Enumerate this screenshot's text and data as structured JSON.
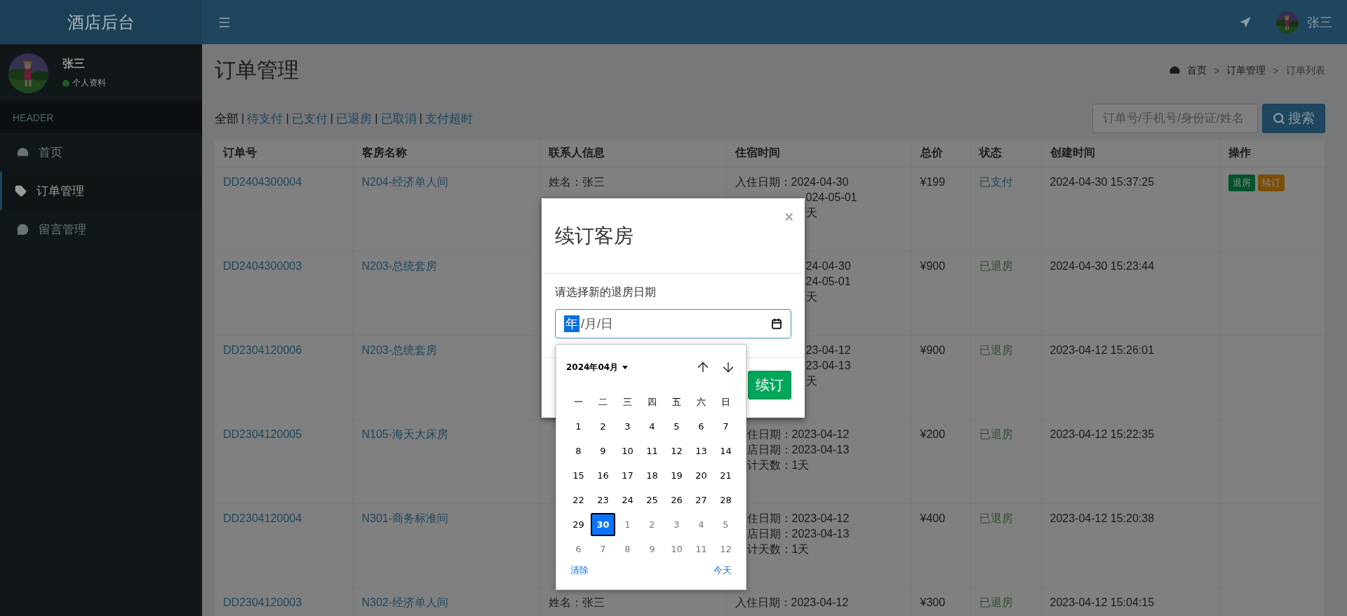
{
  "topbar": {
    "logo": "酒店后台",
    "user": "张三"
  },
  "sidebar": {
    "user": {
      "name": "张三",
      "status": "个人资料"
    },
    "section": "HEADER",
    "items": [
      {
        "label": "首页",
        "selected": false
      },
      {
        "label": "订单管理",
        "selected": true
      },
      {
        "label": "留言管理",
        "selected": false
      }
    ]
  },
  "page": {
    "title": "订单管理",
    "breadcrumb": {
      "separator": ">",
      "items": [
        "首页",
        "订单管理",
        "订单列表"
      ]
    }
  },
  "filters": {
    "separator": "|",
    "items": [
      {
        "label": "全部",
        "selected": true
      },
      {
        "label": "待支付",
        "selected": false
      },
      {
        "label": "已支付",
        "selected": false
      },
      {
        "label": "已退房",
        "selected": false
      },
      {
        "label": "已取消",
        "selected": false
      },
      {
        "label": "支付超时",
        "selected": false
      }
    ]
  },
  "search": {
    "placeholder": "订单号/手机号/身份证/姓名",
    "button": "搜索"
  },
  "table": {
    "columns": [
      "订单号",
      "客房名称",
      "联系人信息",
      "住宿时间",
      "总价",
      "状态",
      "创建时间",
      "操作"
    ],
    "rows": [
      {
        "order": "DD2404300004",
        "room": "N204-经济单人间",
        "contact": [
          "姓名：张三"
        ],
        "stay": [
          {
            "text": "入住日期：2024-04-30",
            "kind": "whole"
          },
          {
            "text": "024-05-01",
            "kind": "after_modal"
          },
          {
            "text": "天",
            "kind": "after_modal"
          }
        ],
        "price": "¥199",
        "status": {
          "text": "已支付",
          "color": "#1e465e"
        },
        "created": "2024-04-30 15:37:25",
        "actions": [
          {
            "label": "退房",
            "color": "#00532d"
          },
          {
            "label": "续订",
            "color": "#7a4e09"
          }
        ]
      },
      {
        "order": "DD2404300003",
        "room": "N203-总统套房",
        "stay": [
          {
            "text": "24-04-30",
            "kind": "after_modal"
          },
          {
            "text": "24-05-01",
            "kind": "after_modal"
          },
          {
            "text": "天",
            "kind": "after_modal"
          }
        ],
        "price": "¥900",
        "status": {
          "text": "已退房",
          "color": "#2f4f2f"
        },
        "created": "2024-04-30 15:23:44"
      },
      {
        "order": "DD2304120006",
        "room": "N203-总统套房",
        "stay": [
          {
            "text": "23-04-12",
            "kind": "after_modal"
          },
          {
            "text": "23-04-13",
            "kind": "after_modal"
          },
          {
            "text": "天",
            "kind": "after_modal"
          }
        ],
        "price": "¥900",
        "status": {
          "text": "已退房",
          "color": "#2f4f2f"
        },
        "created": "2023-04-12 15:26:01"
      },
      {
        "order": "DD2304120005",
        "room": "N105-海天大床房",
        "stay": [
          {
            "text": "住日期：2023-04-12",
            "kind": "after_picker"
          },
          {
            "text": "店日期：2023-04-13",
            "kind": "after_picker"
          },
          {
            "text": "计天数：1天",
            "kind": "after_picker"
          }
        ],
        "price": "¥200",
        "status": {
          "text": "已退房",
          "color": "#2f4f2f"
        },
        "created": "2023-04-12 15:22:35"
      },
      {
        "order": "DD2304120004",
        "room": "N301-商务标准间",
        "stay": [
          {
            "text": "住日期：2023-04-12",
            "kind": "after_picker"
          },
          {
            "text": "店日期：2023-04-13",
            "kind": "after_picker"
          },
          {
            "text": "计天数：1天",
            "kind": "after_picker"
          }
        ],
        "price": "¥400",
        "status": {
          "text": "已退房",
          "color": "#2f4f2f"
        },
        "created": "2023-04-12 15:20:38"
      },
      {
        "order": "DD2304120003",
        "room": "N302-经济单人间",
        "contact": [
          "姓名：张三"
        ],
        "stay": [
          {
            "text": "入住日期：2023-04-12",
            "kind": "whole"
          }
        ],
        "price": "¥300",
        "status": {
          "text": "已退房",
          "color": "#2f4f2f"
        },
        "created": "2023-04-12 15:04:15"
      }
    ]
  },
  "modal": {
    "title": "续订客房",
    "close": "×",
    "label": "请选择新的退房日期",
    "date_field": [
      {
        "text": "年",
        "selected": true
      },
      {
        "text": "/月/日",
        "selected": false
      }
    ],
    "button": "续订"
  },
  "calendar": {
    "month": "2024年04月",
    "weekdays": [
      "一",
      "二",
      "三",
      "四",
      "五",
      "六",
      "日"
    ],
    "weeks": [
      [
        {
          "day": "1",
          "outside": false,
          "selected": false
        },
        {
          "day": "2",
          "outside": false,
          "selected": false
        },
        {
          "day": "3",
          "outside": false,
          "selected": false
        },
        {
          "day": "4",
          "outside": false,
          "selected": false
        },
        {
          "day": "5",
          "outside": false,
          "selected": false
        },
        {
          "day": "6",
          "outside": false,
          "selected": false
        },
        {
          "day": "7",
          "outside": false,
          "selected": false
        }
      ],
      [
        {
          "day": "8",
          "outside": false,
          "selected": false
        },
        {
          "day": "9",
          "outside": false,
          "selected": false
        },
        {
          "day": "10",
          "outside": false,
          "selected": false
        },
        {
          "day": "11",
          "outside": false,
          "selected": false
        },
        {
          "day": "12",
          "outside": false,
          "selected": false
        },
        {
          "day": "13",
          "outside": false,
          "selected": false
        },
        {
          "day": "14",
          "outside": false,
          "selected": false
        }
      ],
      [
        {
          "day": "15",
          "outside": false,
          "selected": false
        },
        {
          "day": "16",
          "outside": false,
          "selected": false
        },
        {
          "day": "17",
          "outside": false,
          "selected": false
        },
        {
          "day": "18",
          "outside": false,
          "selected": false
        },
        {
          "day": "19",
          "outside": false,
          "selected": false
        },
        {
          "day": "20",
          "outside": false,
          "selected": false
        },
        {
          "day": "21",
          "outside": false,
          "selected": false
        }
      ],
      [
        {
          "day": "22",
          "outside": false,
          "selected": false
        },
        {
          "day": "23",
          "outside": false,
          "selected": false
        },
        {
          "day": "24",
          "outside": false,
          "selected": false
        },
        {
          "day": "25",
          "outside": false,
          "selected": false
        },
        {
          "day": "26",
          "outside": false,
          "selected": false
        },
        {
          "day": "27",
          "outside": false,
          "selected": false
        },
        {
          "day": "28",
          "outside": false,
          "selected": false
        }
      ],
      [
        {
          "day": "29",
          "outside": false,
          "selected": false
        },
        {
          "day": "30",
          "outside": false,
          "selected": true
        },
        {
          "day": "1",
          "outside": true,
          "selected": false
        },
        {
          "day": "2",
          "outside": true,
          "selected": false
        },
        {
          "day": "3",
          "outside": true,
          "selected": false
        },
        {
          "day": "4",
          "outside": true,
          "selected": false
        },
        {
          "day": "5",
          "outside": true,
          "selected": false
        }
      ],
      [
        {
          "day": "6",
          "outside": true,
          "selected": false
        },
        {
          "day": "7",
          "outside": true,
          "selected": false
        },
        {
          "day": "8",
          "outside": true,
          "selected": false
        },
        {
          "day": "9",
          "outside": true,
          "selected": false
        },
        {
          "day": "10",
          "outside": true,
          "selected": false
        },
        {
          "day": "11",
          "outside": true,
          "selected": false
        },
        {
          "day": "12",
          "outside": true,
          "selected": false
        }
      ]
    ],
    "clear": "清除",
    "today": "今天"
  }
}
